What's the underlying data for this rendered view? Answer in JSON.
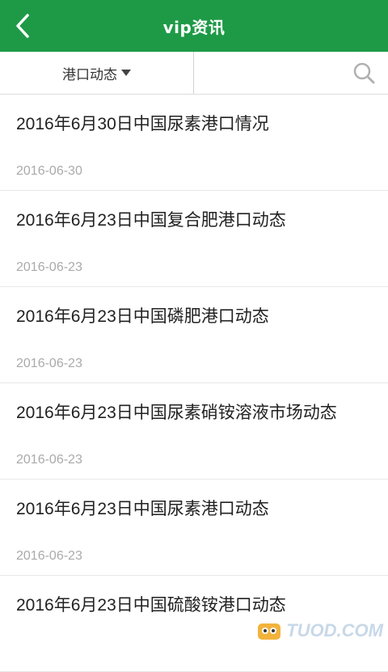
{
  "header": {
    "title": "vip资讯",
    "back_icon": "chevron-left-icon"
  },
  "filter": {
    "category": "港口动态",
    "search_icon": "search-icon"
  },
  "articles": [
    {
      "title": "2016年6月30日中国尿素港口情况",
      "date": "2016-06-30"
    },
    {
      "title": "2016年6月23日中国复合肥港口动态",
      "date": "2016-06-23"
    },
    {
      "title": "2016年6月23日中国磷肥港口动态",
      "date": "2016-06-23"
    },
    {
      "title": "2016年6月23日中国尿素硝铵溶液市场动态",
      "date": "2016-06-23"
    },
    {
      "title": "2016年6月23日中国尿素港口动态",
      "date": "2016-06-23"
    },
    {
      "title": "2016年6月23日中国硫酸铵港口动态",
      "date": ""
    }
  ],
  "watermark": {
    "text": "TUOD.COM"
  },
  "colors": {
    "primary": "#1e9a47",
    "date": "#aaaaaa"
  }
}
